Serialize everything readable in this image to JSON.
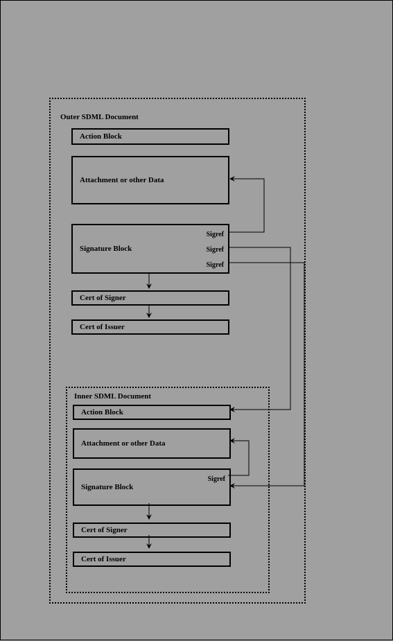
{
  "outer": {
    "title": "Outer SDML Document",
    "action": "Action Block",
    "attachment": "Attachment or other Data",
    "signature": "Signature Block",
    "sigref1": "Sigref",
    "sigref2": "Sigref",
    "sigref3": "Sigref",
    "certSigner": "Cert of Signer",
    "certIssuer": "Cert of Issuer"
  },
  "inner": {
    "title": "Inner SDML Document",
    "action": "Action Block",
    "attachment": "Attachment or other Data",
    "signature": "Signature Block",
    "sigref1": "Sigref",
    "certSigner": "Cert of Signer",
    "certIssuer": "Cert of Issuer"
  }
}
